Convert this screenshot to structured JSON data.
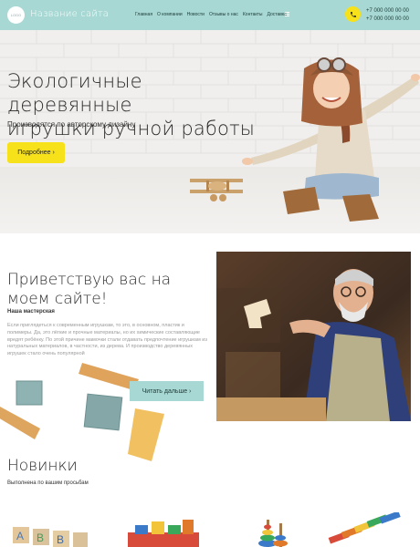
{
  "header": {
    "logo_text": "LOGO",
    "site_name": "Название сайта",
    "nav": [
      "Главная",
      "О компании",
      "Новости",
      "Отзывы о нас",
      "Контакты",
      "Доставка"
    ],
    "phones": [
      "+7 000 000 00 00",
      "+7 000 000 00 00"
    ]
  },
  "hero": {
    "title_line1": "Экологичные деревянные",
    "title_line2": "игрушки ручной работы",
    "subtitle": "Производятся по авторскому дизайну",
    "button": "Подробнее ›"
  },
  "intro": {
    "title": "Приветствую вас на моем сайте!",
    "subtitle": "Наша мастерская",
    "text": "Если приглядеться к современным игрушкам, то это, в основном, пластик и полимеры. Да, это лёгкие и прочные материалы, но их химические составляющие вредят ребёнку. По этой причине мамочки стали отдавать предпочтение игрушкам из натуральных материалов, в частности, из дерева. И производство деревянных игрушек стало очень популярной",
    "button": "Читать дальше ›"
  },
  "new": {
    "title": "Новинки",
    "subtitle": "Выполнена по вашим просьбам"
  },
  "colors": {
    "header_bg": "#a8d8d3",
    "accent_yellow": "#f7e11a",
    "teal_button": "#a8d8d3"
  }
}
